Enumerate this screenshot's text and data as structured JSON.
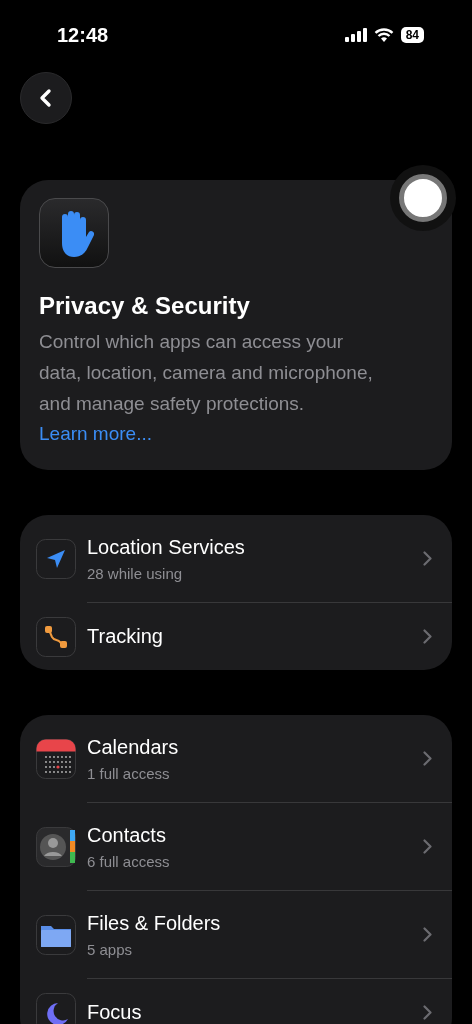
{
  "status_bar": {
    "time": "12:48",
    "battery": "84"
  },
  "header": {
    "title": "Privacy & Security",
    "description": "Control which apps can access your data, location, camera and microphone, and manage safety protections.",
    "link": "Learn more..."
  },
  "groups": [
    {
      "items": [
        {
          "kind": "location",
          "title": "Location Services",
          "subtitle": "28 while using"
        },
        {
          "kind": "tracking",
          "title": "Tracking"
        }
      ]
    },
    {
      "items": [
        {
          "kind": "calendar",
          "title": "Calendars",
          "subtitle": "1 full access"
        },
        {
          "kind": "contacts",
          "title": "Contacts",
          "subtitle": "6 full access"
        },
        {
          "kind": "files",
          "title": "Files & Folders",
          "subtitle": "5 apps"
        },
        {
          "kind": "focus",
          "title": "Focus"
        }
      ]
    }
  ]
}
